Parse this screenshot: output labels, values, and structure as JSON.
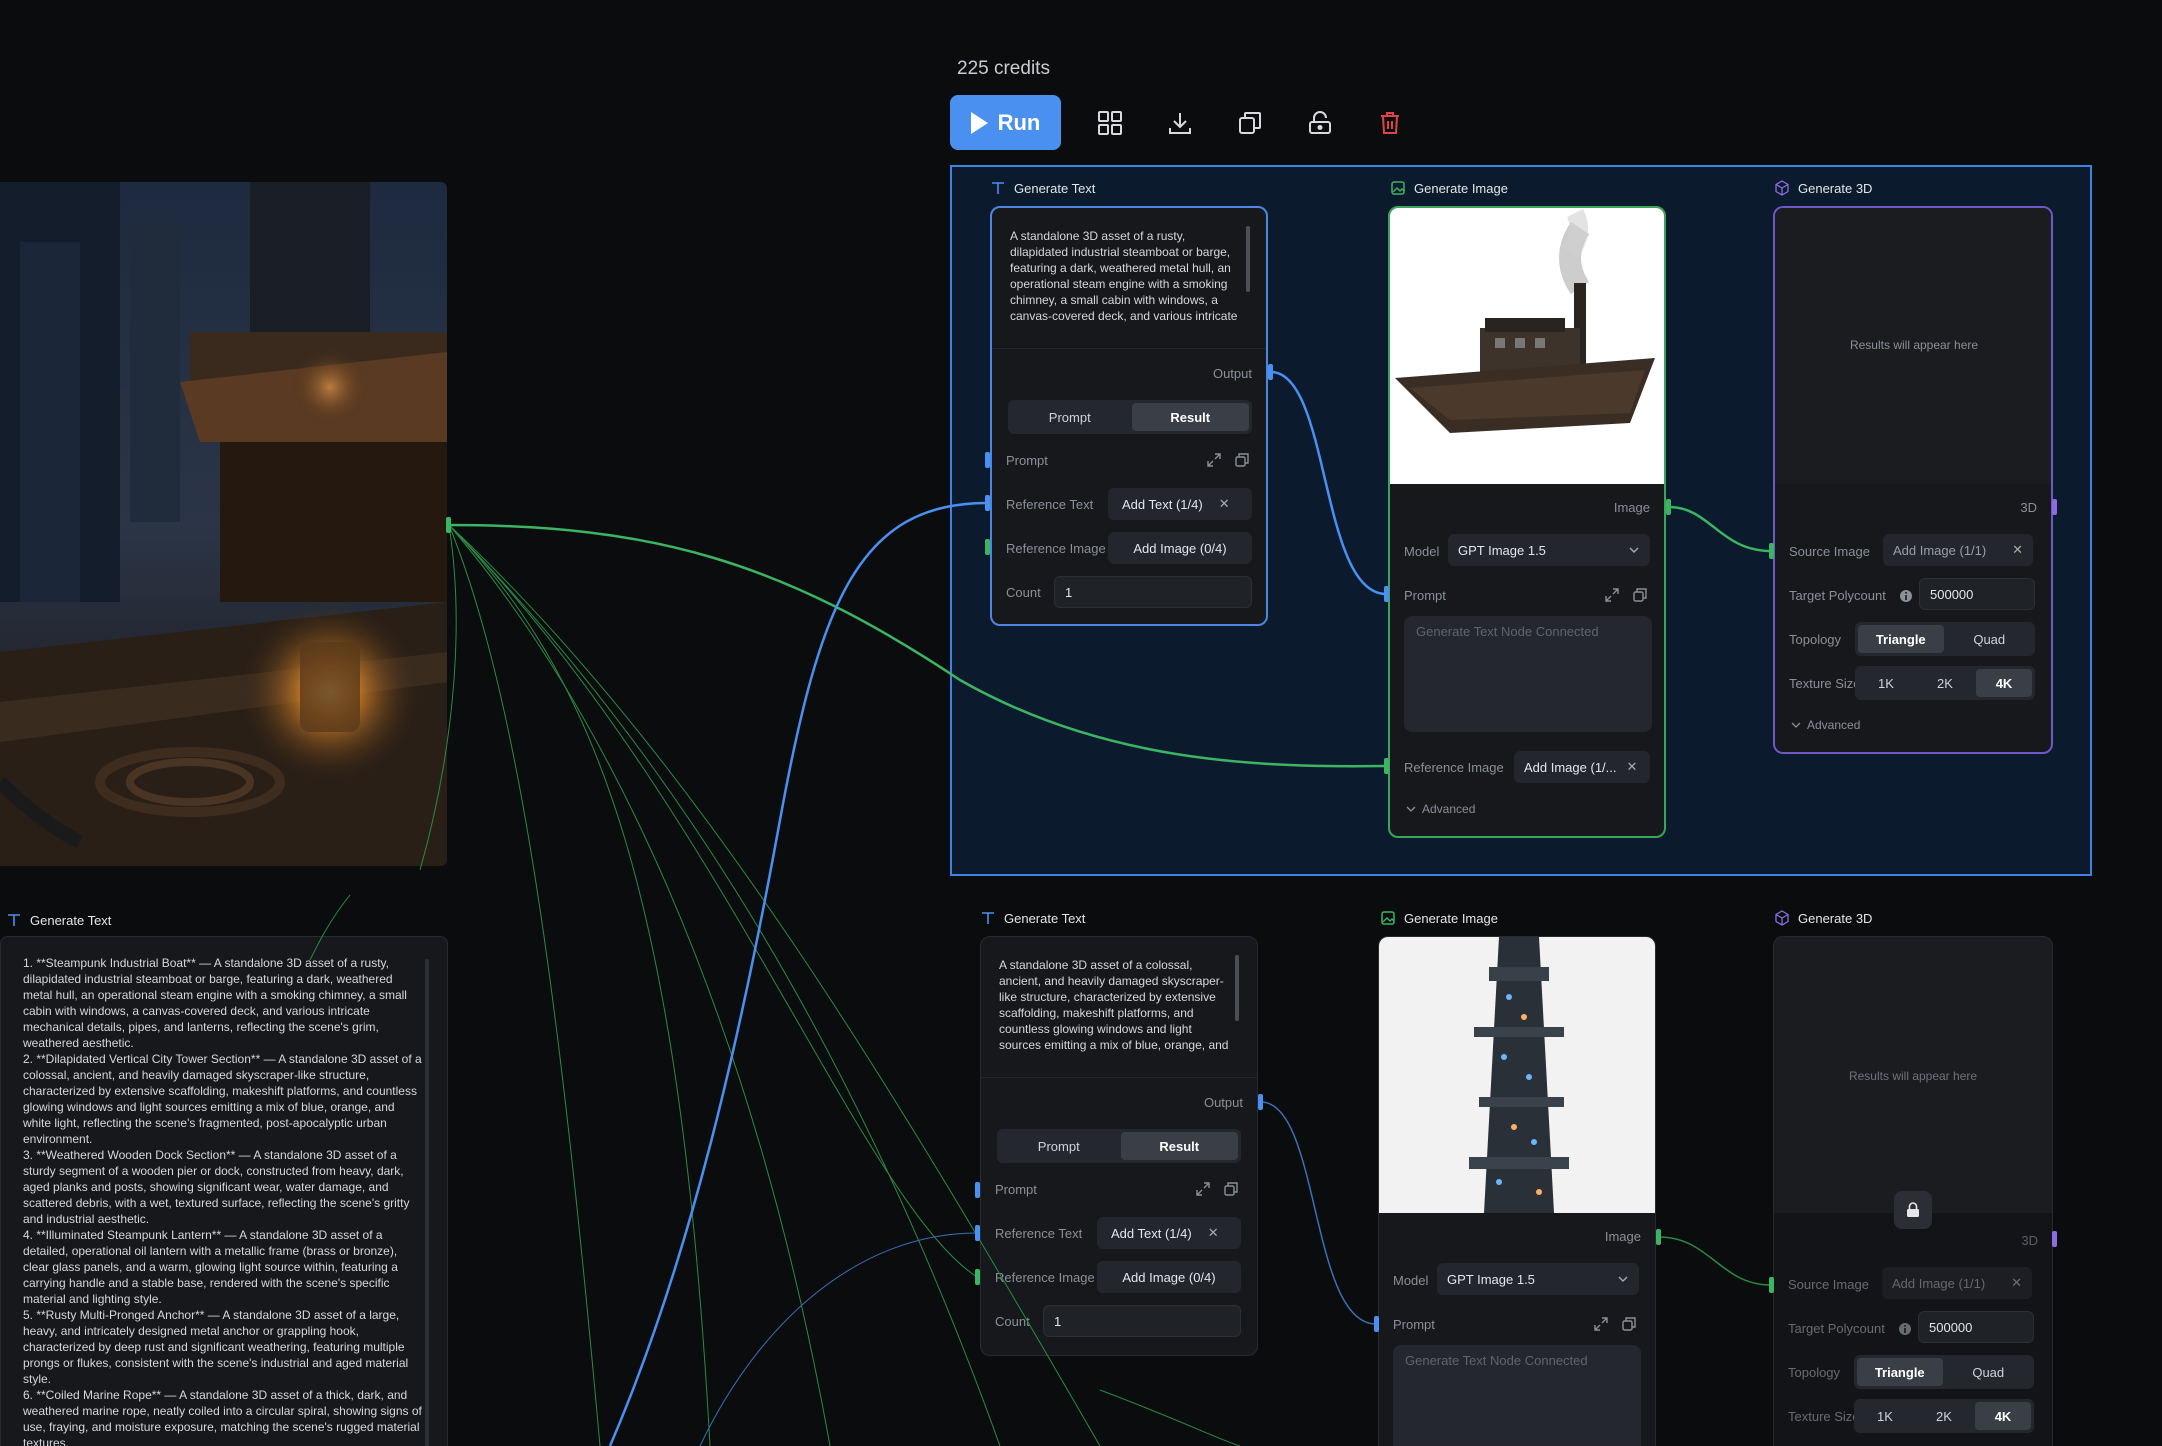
{
  "credits": "225 credits",
  "toolbar": {
    "run_label": "Run"
  },
  "colors": {
    "accent": "#4a90f0",
    "green": "#3bb563",
    "purple": "#8b6de0",
    "delete": "#e0444a"
  },
  "left_panel": {
    "title": "Generate Text",
    "text": "1. **Steampunk Industrial Boat** — A standalone 3D asset of a rusty, dilapidated industrial steamboat or barge, featuring a dark, weathered metal hull, an operational steam engine with a smoking chimney, a small cabin with windows, a canvas-covered deck, and various intricate mechanical details, pipes, and lanterns, reflecting the scene's grim, weathered aesthetic.\n2. **Dilapidated Vertical City Tower Section** — A standalone 3D asset of a colossal, ancient, and heavily damaged skyscraper-like structure, characterized by extensive scaffolding, makeshift platforms, and countless glowing windows and light sources emitting a mix of blue, orange, and white light, reflecting the scene's fragmented, post-apocalyptic urban environment.\n3. **Weathered Wooden Dock Section** — A standalone 3D asset of a sturdy segment of a wooden pier or dock, constructed from heavy, dark, aged planks and posts, showing significant wear, water damage, and scattered debris, with a wet, textured surface, reflecting the scene's gritty and industrial aesthetic.\n4. **Illuminated Steampunk Lantern** — A standalone 3D asset of a detailed, operational oil lantern with a metallic frame (brass or bronze), clear glass panels, and a warm, glowing light source within, featuring a carrying handle and a stable base, rendered with the scene's specific material and lighting style.\n5. **Rusty Multi-Pronged Anchor** — A standalone 3D asset of a large, heavy, and intricately designed metal anchor or grappling hook, characterized by deep rust and significant weathering, featuring multiple prongs or flukes, consistent with the scene's industrial and aged material style.\n6. **Coiled Marine Rope** — A standalone 3D asset of a thick, dark, and weathered marine rope, neatly coiled into a circular spiral, showing signs of use, fraying, and moisture exposure, matching the scene's rugged material textures."
  },
  "rows": [
    {
      "text_node": {
        "title": "Generate Text",
        "prompt": "A standalone 3D asset of a rusty, dilapidated industrial steamboat or barge, featuring a dark, weathered metal hull, an operational steam engine with a smoking chimney, a small cabin with windows, a canvas-covered deck, and various intricate mechanical details, pipes, and lanterns",
        "output_label": "Output",
        "tab_prompt": "Prompt",
        "tab_result": "Result",
        "prompt_label": "Prompt",
        "ref_text_label": "Reference Text",
        "ref_text_value": "Add Text (1/4)",
        "ref_image_label": "Reference Image",
        "ref_image_value": "Add Image (0/4)",
        "count_label": "Count",
        "count_value": "1"
      },
      "image_node": {
        "title": "Generate Image",
        "image_label": "Image",
        "model_label": "Model",
        "model_value": "GPT Image 1.5",
        "prompt_label": "Prompt",
        "prompt_placeholder": "Generate Text Node Connected",
        "ref_image_label": "Reference Image",
        "ref_image_value": "Add Image (1/...",
        "advanced_label": "Advanced"
      },
      "model_node": {
        "title": "Generate 3D",
        "placeholder": "Results will appear here",
        "output_label": "3D",
        "source_label": "Source Image",
        "source_value": "Add Image (1/1)",
        "polycount_label": "Target Polycount",
        "polycount_value": "500000",
        "topology_label": "Topology",
        "topology_options": [
          "Triangle",
          "Quad"
        ],
        "texture_label": "Texture Size",
        "texture_options": [
          "1K",
          "2K",
          "4K"
        ],
        "advanced_label": "Advanced"
      }
    },
    {
      "text_node": {
        "title": "Generate Text",
        "prompt": "A standalone 3D asset of a colossal, ancient, and heavily damaged skyscraper-like structure, characterized by extensive scaffolding, makeshift platforms, and countless glowing windows and light sources emitting a mix of blue, orange, and white light, reflecting the scene's",
        "output_label": "Output",
        "tab_prompt": "Prompt",
        "tab_result": "Result",
        "prompt_label": "Prompt",
        "ref_text_label": "Reference Text",
        "ref_text_value": "Add Text (1/4)",
        "ref_image_label": "Reference Image",
        "ref_image_value": "Add Image (0/4)",
        "count_label": "Count",
        "count_value": "1"
      },
      "image_node": {
        "title": "Generate Image",
        "image_label": "Image",
        "model_label": "Model",
        "model_value": "GPT Image 1.5",
        "prompt_label": "Prompt",
        "prompt_placeholder": "Generate Text Node Connected"
      },
      "model_node": {
        "title": "Generate 3D",
        "placeholder": "Results will appear here",
        "output_label": "3D",
        "source_label": "Source Image",
        "source_value": "Add Image (1/1)",
        "polycount_label": "Target Polycount",
        "polycount_value": "500000",
        "topology_label": "Topology",
        "topology_options": [
          "Triangle",
          "Quad"
        ],
        "texture_label": "Texture Size",
        "texture_options": [
          "1K",
          "2K",
          "4K"
        ]
      }
    }
  ]
}
